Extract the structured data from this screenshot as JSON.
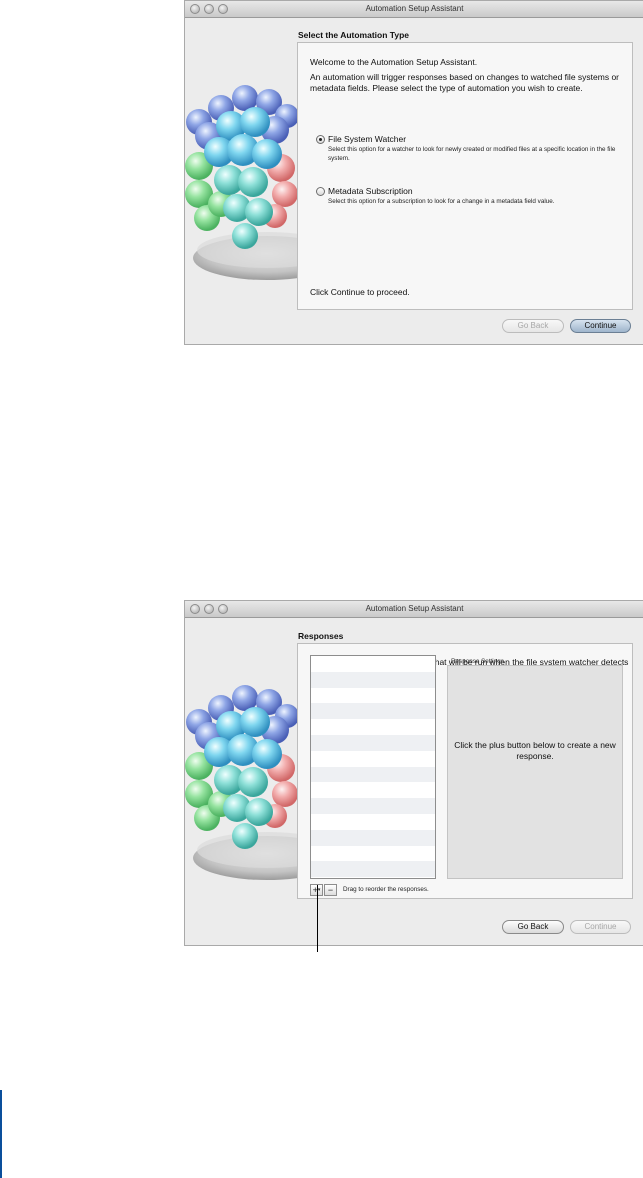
{
  "window1": {
    "title": "Automation Setup Assistant",
    "section_title": "Select the Automation Type",
    "welcome": "Welcome to the Automation Setup Assistant.",
    "intro": "An automation will trigger responses based on changes to watched file systems or metadata fields. Please select the type of automation you wish to create.",
    "options": [
      {
        "label": "File System Watcher",
        "selected": true,
        "description": "Select this option for a watcher to look for newly created or modified files at a specific location in the file system."
      },
      {
        "label": "Metadata Subscription",
        "selected": false,
        "description": "Select this option for a subscription to look for a change in a metadata field value."
      }
    ],
    "footer_text": "Click Continue to proceed.",
    "buttons": {
      "back": "Go Back",
      "continue": "Continue"
    }
  },
  "window2": {
    "title": "Automation Setup Assistant",
    "section_title": "Responses",
    "intro": "Create copy or email responses that will be run when the file system watcher detects new or changed files.",
    "settings_label": "Response Settings",
    "empty_message": "Click the plus button below to create a new response.",
    "add_label": "+",
    "add_menu_glyph": "▾",
    "remove_label": "−",
    "drag_hint": "Drag to reorder the responses.",
    "buttons": {
      "back": "Go Back",
      "continue": "Continue"
    }
  },
  "colors": {
    "window_bg": "#ececec",
    "panel_bg": "#f7f7f7",
    "settings_bg": "#e2e2e2",
    "margin_bar": "#0a4f9c"
  },
  "icons": [
    "close-light",
    "minimize-light",
    "zoom-light",
    "spheres-artwork"
  ]
}
